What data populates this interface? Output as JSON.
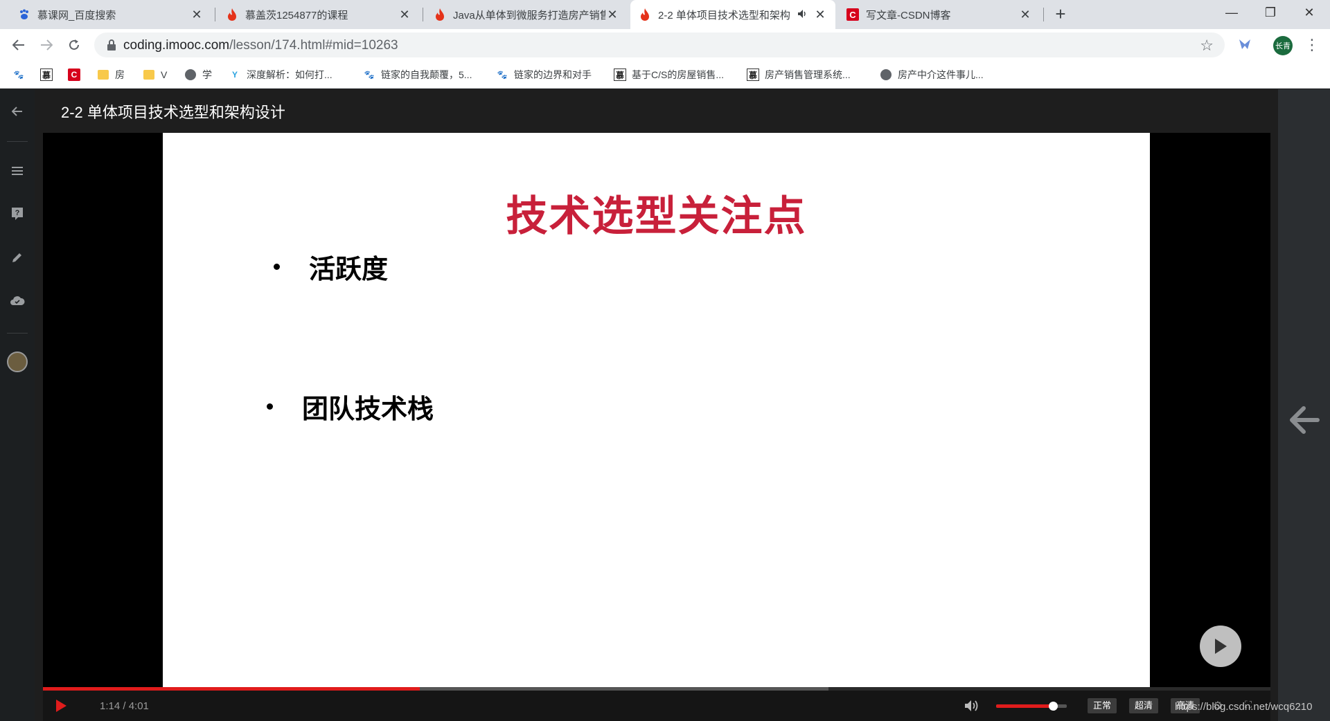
{
  "browser": {
    "tabs": [
      {
        "title": "慕课网_百度搜索",
        "favicon": "baidu-paw-icon",
        "active": false
      },
      {
        "title": "慕盖茨1254877的课程",
        "favicon": "imooc-flame-icon",
        "active": false
      },
      {
        "title": "Java从单体到微服务打造房产销售",
        "favicon": "imooc-flame-icon",
        "active": false
      },
      {
        "title": "2-2 单体项目技术选型和架构",
        "favicon": "imooc-flame-icon",
        "active": true,
        "audio": true
      },
      {
        "title": "写文章-CSDN博客",
        "favicon": "csdn-c-icon",
        "active": false
      }
    ],
    "tab_close_glyph": "✕",
    "new_tab_glyph": "+",
    "window": {
      "minimize": "—",
      "restore": "❐",
      "close": "✕"
    },
    "address": {
      "host": "coding.imooc.com",
      "path": "/lesson/174.html#mid=10263"
    },
    "profile_initials": "长青",
    "accent_color": "#1b6b3e"
  },
  "bookmarks": [
    {
      "label": "",
      "icon": "baidu-paw-icon"
    },
    {
      "label": "",
      "icon": "imooc-logo-icon"
    },
    {
      "label": "",
      "icon": "csdn-c-icon"
    },
    {
      "label": "房",
      "icon": "folder-icon"
    },
    {
      "label": "V",
      "icon": "folder-icon"
    },
    {
      "label": "学",
      "icon": "globe-icon"
    },
    {
      "label": "深度解析：如何打...",
      "icon": "y-logo-icon"
    },
    {
      "label": "链家的自我颠覆，5...",
      "icon": "baidu-paw-icon"
    },
    {
      "label": "链家的边界和对手",
      "icon": "baidu-paw-icon"
    },
    {
      "label": "基于C/S的房屋销售...",
      "icon": "imooc-logo-icon"
    },
    {
      "label": "房产销售管理系统...",
      "icon": "imooc-logo-icon"
    },
    {
      "label": "房产中介这件事儿...",
      "icon": "globe-icon"
    }
  ],
  "lesson": {
    "title": "2-2 单体项目技术选型和架构设计"
  },
  "slide": {
    "title": "技术选型关注点",
    "bullets": [
      "活跃度",
      "团队技术栈"
    ],
    "title_color": "#c8203a"
  },
  "player": {
    "current_time": "1:14",
    "duration": "4:01",
    "time_display": "1:14 / 4:01",
    "progress_fraction": 0.307,
    "buffered_fraction": 0.64,
    "volume_fraction": 0.8,
    "quality_options": [
      "正常",
      "超清",
      "高清"
    ],
    "accent_color": "#e01c1c"
  },
  "watermark": "https://blog.csdn.net/wcq6210"
}
